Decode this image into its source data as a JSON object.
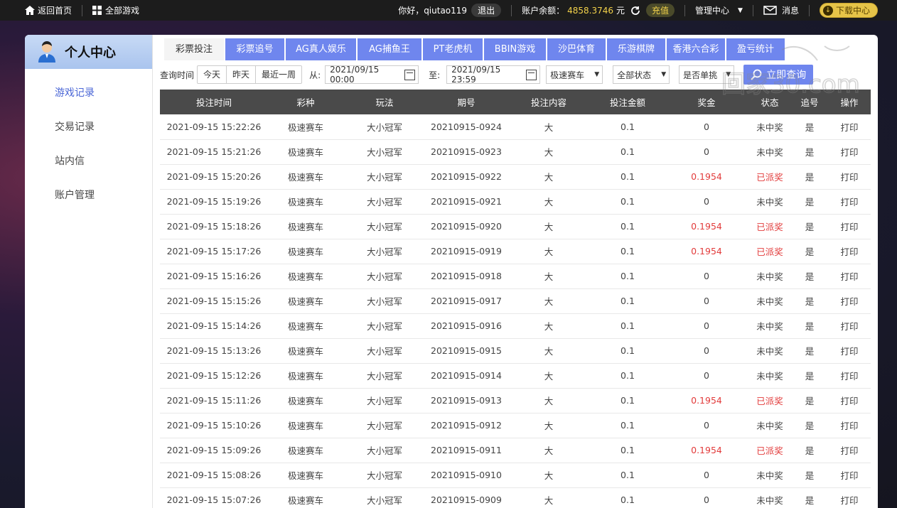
{
  "topbar": {
    "home": "返回首页",
    "all_games": "全部游戏",
    "greeting": "你好，qiutao119",
    "logout": "退出",
    "balance_label": "账户余额：",
    "balance_value": "4858.3746",
    "balance_unit": "元",
    "recharge": "充值",
    "admin": "管理中心",
    "messages": "消息",
    "download": "下载中心"
  },
  "sidebar": {
    "title": "个人中心",
    "items": [
      {
        "label": "游戏记录",
        "active": true
      },
      {
        "label": "交易记录",
        "active": false
      },
      {
        "label": "站内信",
        "active": false
      },
      {
        "label": "账户管理",
        "active": false
      }
    ]
  },
  "tabs": [
    {
      "label": "彩票投注",
      "active": true
    },
    {
      "label": "彩票追号"
    },
    {
      "label": "AG真人娱乐"
    },
    {
      "label": "AG捕鱼王"
    },
    {
      "label": "PT老虎机"
    },
    {
      "label": "BBIN游戏"
    },
    {
      "label": "沙巴体育"
    },
    {
      "label": "乐游棋牌"
    },
    {
      "label": "香港六合彩"
    },
    {
      "label": "盈亏统计"
    }
  ],
  "filters": {
    "label": "查询时间",
    "quick": [
      "今天",
      "昨天",
      "最近一周"
    ],
    "from_label": "从:",
    "from_value": "2021/09/15 00:00",
    "to_label": "至:",
    "to_value": "2021/09/15 23:59",
    "game_select": "极速赛车",
    "status_select": "全部状态",
    "single_select": "是否单挑",
    "query_button": "立即查询"
  },
  "table": {
    "columns": [
      "投注时间",
      "彩种",
      "玩法",
      "期号",
      "投注内容",
      "投注金额",
      "奖金",
      "状态",
      "追号",
      "操作"
    ],
    "rows": [
      [
        "2021-09-15 15:22:26",
        "极速赛车",
        "大小冠军",
        "20210915-0924",
        "大",
        "0.1",
        "0",
        "未中奖",
        "是",
        "打印"
      ],
      [
        "2021-09-15 15:21:26",
        "极速赛车",
        "大小冠军",
        "20210915-0923",
        "大",
        "0.1",
        "0",
        "未中奖",
        "是",
        "打印"
      ],
      [
        "2021-09-15 15:20:26",
        "极速赛车",
        "大小冠军",
        "20210915-0922",
        "大",
        "0.1",
        "0.1954",
        "已派奖",
        "是",
        "打印"
      ],
      [
        "2021-09-15 15:19:26",
        "极速赛车",
        "大小冠军",
        "20210915-0921",
        "大",
        "0.1",
        "0",
        "未中奖",
        "是",
        "打印"
      ],
      [
        "2021-09-15 15:18:26",
        "极速赛车",
        "大小冠军",
        "20210915-0920",
        "大",
        "0.1",
        "0.1954",
        "已派奖",
        "是",
        "打印"
      ],
      [
        "2021-09-15 15:17:26",
        "极速赛车",
        "大小冠军",
        "20210915-0919",
        "大",
        "0.1",
        "0.1954",
        "已派奖",
        "是",
        "打印"
      ],
      [
        "2021-09-15 15:16:26",
        "极速赛车",
        "大小冠军",
        "20210915-0918",
        "大",
        "0.1",
        "0",
        "未中奖",
        "是",
        "打印"
      ],
      [
        "2021-09-15 15:15:26",
        "极速赛车",
        "大小冠军",
        "20210915-0917",
        "大",
        "0.1",
        "0",
        "未中奖",
        "是",
        "打印"
      ],
      [
        "2021-09-15 15:14:26",
        "极速赛车",
        "大小冠军",
        "20210915-0916",
        "大",
        "0.1",
        "0",
        "未中奖",
        "是",
        "打印"
      ],
      [
        "2021-09-15 15:13:26",
        "极速赛车",
        "大小冠军",
        "20210915-0915",
        "大",
        "0.1",
        "0",
        "未中奖",
        "是",
        "打印"
      ],
      [
        "2021-09-15 15:12:26",
        "极速赛车",
        "大小冠军",
        "20210915-0914",
        "大",
        "0.1",
        "0",
        "未中奖",
        "是",
        "打印"
      ],
      [
        "2021-09-15 15:11:26",
        "极速赛车",
        "大小冠军",
        "20210915-0913",
        "大",
        "0.1",
        "0.1954",
        "已派奖",
        "是",
        "打印"
      ],
      [
        "2021-09-15 15:10:26",
        "极速赛车",
        "大小冠军",
        "20210915-0912",
        "大",
        "0.1",
        "0",
        "未中奖",
        "是",
        "打印"
      ],
      [
        "2021-09-15 15:09:26",
        "极速赛车",
        "大小冠军",
        "20210915-0911",
        "大",
        "0.1",
        "0.1954",
        "已派奖",
        "是",
        "打印"
      ],
      [
        "2021-09-15 15:08:26",
        "极速赛车",
        "大小冠军",
        "20210915-0910",
        "大",
        "0.1",
        "0",
        "未中奖",
        "是",
        "打印"
      ],
      [
        "2021-09-15 15:07:26",
        "极速赛车",
        "大小冠军",
        "20210915-0909",
        "大",
        "0.1",
        "0",
        "未中奖",
        "是",
        "打印"
      ]
    ]
  },
  "colors": {
    "accent": "#6f86ee",
    "win": "#e23b3b",
    "balance": "#f3d24a",
    "header_bg": "#4a4a4a"
  },
  "watermark": "回家30.com"
}
